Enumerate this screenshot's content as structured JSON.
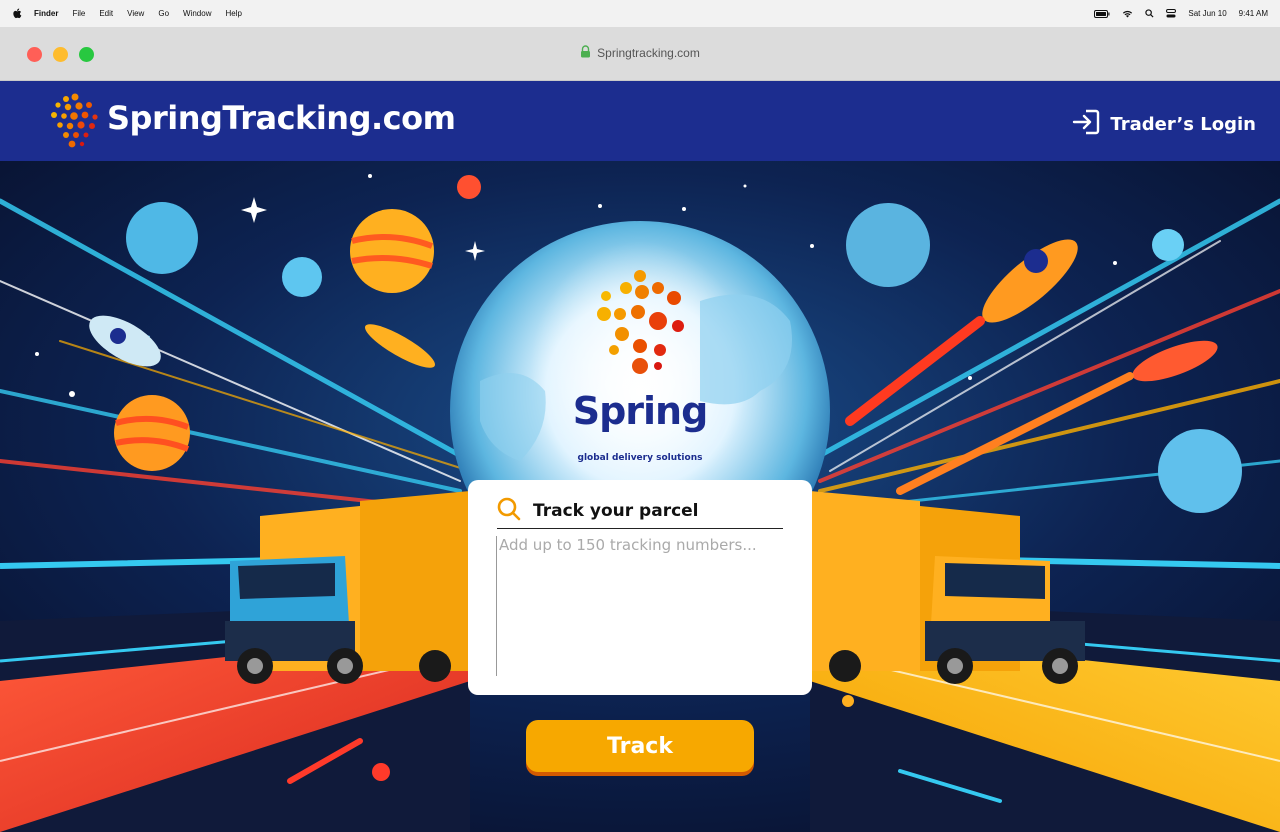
{
  "menubar": {
    "app": "Finder",
    "items": [
      "File",
      "Edit",
      "View",
      "Go",
      "Window",
      "Help"
    ],
    "date": "Sat Jun 10",
    "time": "9:41 AM"
  },
  "browser": {
    "url": "Springtracking.com"
  },
  "header": {
    "brand": "SpringTracking.com",
    "login_label": "Trader’s Login"
  },
  "hero": {
    "logo_word": "Spring",
    "logo_tagline": "global delivery solutions"
  },
  "tracker": {
    "title": "Track your parcel",
    "placeholder": "Add up to 150 tracking numbers...",
    "value": "",
    "button_label": "Track"
  },
  "colors": {
    "header_bg": "#1c2d8f",
    "button": "#f7a800",
    "button_shadow": "#d35a00"
  },
  "icons": [
    "apple-icon",
    "battery-icon",
    "wifi-icon",
    "search-icon",
    "control-center-icon",
    "lock-icon",
    "login-icon",
    "magnifier-icon"
  ]
}
